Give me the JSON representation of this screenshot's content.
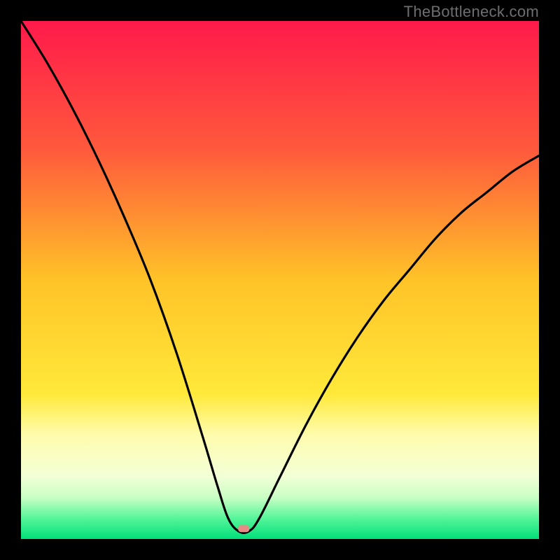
{
  "watermark": "TheBottleneck.com",
  "chart_data": {
    "type": "line",
    "title": "",
    "xlabel": "",
    "ylabel": "",
    "xlim": [
      0,
      100
    ],
    "ylim": [
      0,
      100
    ],
    "x_optimum": 42,
    "marker": {
      "x": 43,
      "y": 2,
      "color": "#E88A85"
    },
    "gradient_stops": [
      {
        "pct": 0,
        "color": "#FF1A4B"
      },
      {
        "pct": 25,
        "color": "#FF5A3C"
      },
      {
        "pct": 50,
        "color": "#FFC328"
      },
      {
        "pct": 72,
        "color": "#FFE93A"
      },
      {
        "pct": 80,
        "color": "#FFFCAE"
      },
      {
        "pct": 88,
        "color": "#F2FFD7"
      },
      {
        "pct": 92,
        "color": "#C9FFC4"
      },
      {
        "pct": 96,
        "color": "#57F59A"
      },
      {
        "pct": 100,
        "color": "#00E07A"
      }
    ],
    "curve_approx": [
      {
        "x": 0,
        "y": 100
      },
      {
        "x": 5,
        "y": 92
      },
      {
        "x": 10,
        "y": 83
      },
      {
        "x": 15,
        "y": 73
      },
      {
        "x": 20,
        "y": 62
      },
      {
        "x": 25,
        "y": 50
      },
      {
        "x": 30,
        "y": 36
      },
      {
        "x": 35,
        "y": 20
      },
      {
        "x": 38,
        "y": 10
      },
      {
        "x": 40,
        "y": 4
      },
      {
        "x": 42,
        "y": 1.5
      },
      {
        "x": 44,
        "y": 1.5
      },
      {
        "x": 46,
        "y": 4
      },
      {
        "x": 50,
        "y": 12
      },
      {
        "x": 55,
        "y": 22
      },
      {
        "x": 60,
        "y": 31
      },
      {
        "x": 65,
        "y": 39
      },
      {
        "x": 70,
        "y": 46
      },
      {
        "x": 75,
        "y": 52
      },
      {
        "x": 80,
        "y": 58
      },
      {
        "x": 85,
        "y": 63
      },
      {
        "x": 90,
        "y": 67
      },
      {
        "x": 95,
        "y": 71
      },
      {
        "x": 100,
        "y": 74
      }
    ]
  }
}
